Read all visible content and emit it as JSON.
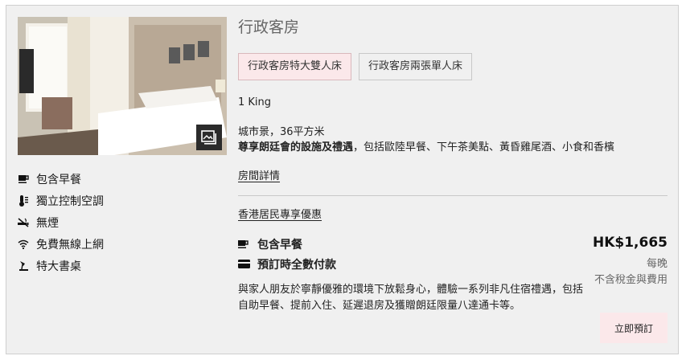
{
  "room": {
    "title": "行政客房",
    "bed_options": [
      "行政客房特大雙人床",
      "行政客房兩張單人床"
    ],
    "bed_type": "1 King",
    "view_size": "城市景，36平方米",
    "desc_bold": "尊享朗廷會的設施及禮遇",
    "desc_rest": "，包括歐陸早餐、下午茶美點、黃昏雞尾酒、小食和香檳",
    "details_link": "房間詳情"
  },
  "amenities": [
    {
      "icon": "coffee-cup-icon",
      "label": "包含早餐"
    },
    {
      "icon": "thermostat-icon",
      "label": "獨立控制空調"
    },
    {
      "icon": "no-smoking-icon",
      "label": "無煙"
    },
    {
      "icon": "wifi-icon",
      "label": "免費無線上網"
    },
    {
      "icon": "desk-lamp-icon",
      "label": "特大書桌"
    }
  ],
  "offer": {
    "title": "香港居民專享優惠",
    "features": [
      {
        "icon": "coffee-cup-icon",
        "label": "包含早餐"
      },
      {
        "icon": "credit-card-icon",
        "label": "預訂時全數付款"
      }
    ],
    "description": "與家人朋友於寧靜優雅的環境下放鬆身心，體驗一系列非凡住宿禮遇，包括自助早餐、提前入住、延遲退房及獲贈朗廷限量八達通卡等。",
    "price": "HK$1,665",
    "per_night": "每晚",
    "tax_note": "不含稅金與費用",
    "book_label": "立即預訂"
  },
  "colors": {
    "accent_pink": "#fbe8ea",
    "card_bg": "#f0f0f0",
    "border": "#c8c8c8"
  }
}
